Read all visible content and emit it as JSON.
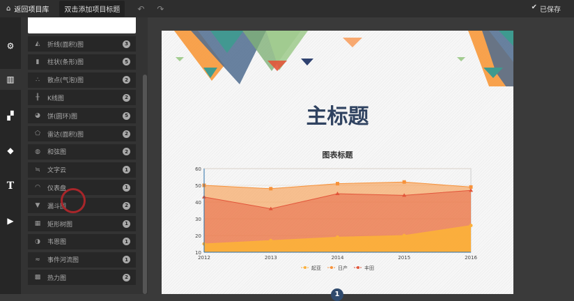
{
  "topbar": {
    "back_label": "返回项目库",
    "title_button": "双击添加项目标题",
    "saved_label": "已保存"
  },
  "sidebar_tabs": [
    "settings",
    "charts",
    "maps",
    "shapes",
    "text",
    "media"
  ],
  "chart_types": [
    {
      "label": "折线(面积)图",
      "count": "3",
      "icon": "area-chart-icon"
    },
    {
      "label": "柱状(条形)图",
      "count": "5",
      "icon": "bar-chart-icon"
    },
    {
      "label": "散点(气泡)图",
      "count": "2",
      "icon": "scatter-icon"
    },
    {
      "label": "K线图",
      "count": "2",
      "icon": "candlestick-icon"
    },
    {
      "label": "饼(圆环)图",
      "count": "5",
      "icon": "pie-icon"
    },
    {
      "label": "雷达(面积)图",
      "count": "2",
      "icon": "radar-icon"
    },
    {
      "label": "和弦图",
      "count": "2",
      "icon": "chord-icon"
    },
    {
      "label": "文字云",
      "count": "1",
      "icon": "wordcloud-icon"
    },
    {
      "label": "仪表盘",
      "count": "1",
      "icon": "gauge-icon"
    },
    {
      "label": "漏斗图",
      "count": "2",
      "icon": "funnel-icon"
    },
    {
      "label": "矩形树图",
      "count": "1",
      "icon": "treemap-icon"
    },
    {
      "label": "韦恩图",
      "count": "1",
      "icon": "venn-icon"
    },
    {
      "label": "事件河流图",
      "count": "1",
      "icon": "eventriver-icon"
    },
    {
      "label": "热力图",
      "count": "2",
      "icon": "heatmap-icon"
    }
  ],
  "page": {
    "main_title": "主标题",
    "pager_current": "1"
  },
  "chart_data": {
    "type": "area",
    "title": "图表标题",
    "x": [
      "2012",
      "2013",
      "2014",
      "2015",
      "2016"
    ],
    "ylim": [
      10,
      60
    ],
    "yticks": [
      "10",
      "20",
      "30",
      "40",
      "50",
      "60"
    ],
    "legend_position": "bottom",
    "series": [
      {
        "name": "起亚",
        "values": [
          15,
          17,
          19,
          20,
          26
        ],
        "color": "#fbb03b"
      },
      {
        "name": "日产",
        "values": [
          50,
          48,
          51,
          52,
          49
        ],
        "color": "#f7923a"
      },
      {
        "name": "丰田",
        "values": [
          43,
          36,
          45,
          44,
          47
        ],
        "color": "#e2553a"
      }
    ]
  }
}
